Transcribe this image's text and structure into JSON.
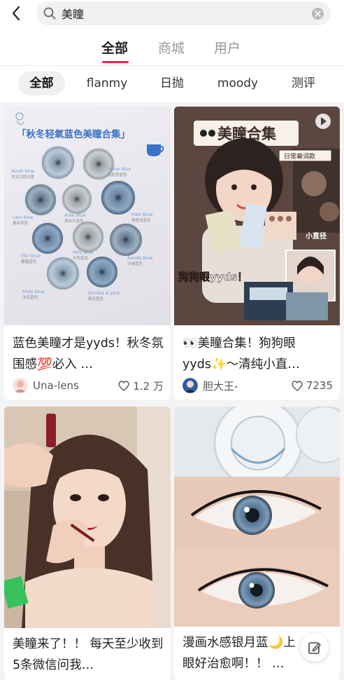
{
  "search": {
    "query": "美瞳"
  },
  "tabs": [
    {
      "label": "全部",
      "active": true
    },
    {
      "label": "商城",
      "active": false
    },
    {
      "label": "用户",
      "active": false
    }
  ],
  "chips": [
    {
      "label": "全部",
      "active": true
    },
    {
      "label": "flanmy",
      "active": false
    },
    {
      "label": "日抛",
      "active": false
    },
    {
      "label": "moody",
      "active": false
    },
    {
      "label": "测评",
      "active": false
    }
  ],
  "cards": [
    {
      "title": "蓝色美瞳才是yyds！秋冬氛围感💯必入 …",
      "author": "Una-lens",
      "likes": "1.2 万",
      "overlay_title": "「秋冬轻氧蓝色美瞳合集」",
      "lens_labels": [
        {
          "name": "Nordi blue",
          "note": "法式北欧冰蓝"
        },
        {
          "name": "Snow blue",
          "note": "北欧雪蓝色"
        },
        {
          "name": "Lavi blue",
          "note": "薰衣草色"
        },
        {
          "name": "Aide blue",
          "note": "混血灰蓝色"
        },
        {
          "name": "Haki blue",
          "note": "清透浅蓝色"
        },
        {
          "name": "Milk blue",
          "note": "牛奶蓝色"
        },
        {
          "name": "Fitri blue",
          "note": "雾霾蓝色"
        },
        {
          "name": "Sande blue",
          "note": "沙滩蓝色"
        },
        {
          "name": "Frobi blue",
          "note": "冰岛蓝色"
        },
        {
          "name": "Dunika & pink",
          "note": "粉灰蓝色"
        }
      ]
    },
    {
      "title": "👀美瞳合集！狗狗眼yyds✨～清纯小直…",
      "author": "胆大王-",
      "likes": "7235",
      "overlay_title": "美瞳合集",
      "overlay_tag": "日常幕词款",
      "overlay_caption": "狗狗眼yyds！",
      "overlay_side": "小直径"
    },
    {
      "title": "美瞳来了！！ 每天至少收到5条微信问我…"
    },
    {
      "title": "漫画水感银月蓝🌙上眼好治愈啊！！ …"
    }
  ],
  "colors": {
    "accent": "#ff2442",
    "card1_bg": "#e9e7ee",
    "card2_bg": "#6b5448"
  }
}
